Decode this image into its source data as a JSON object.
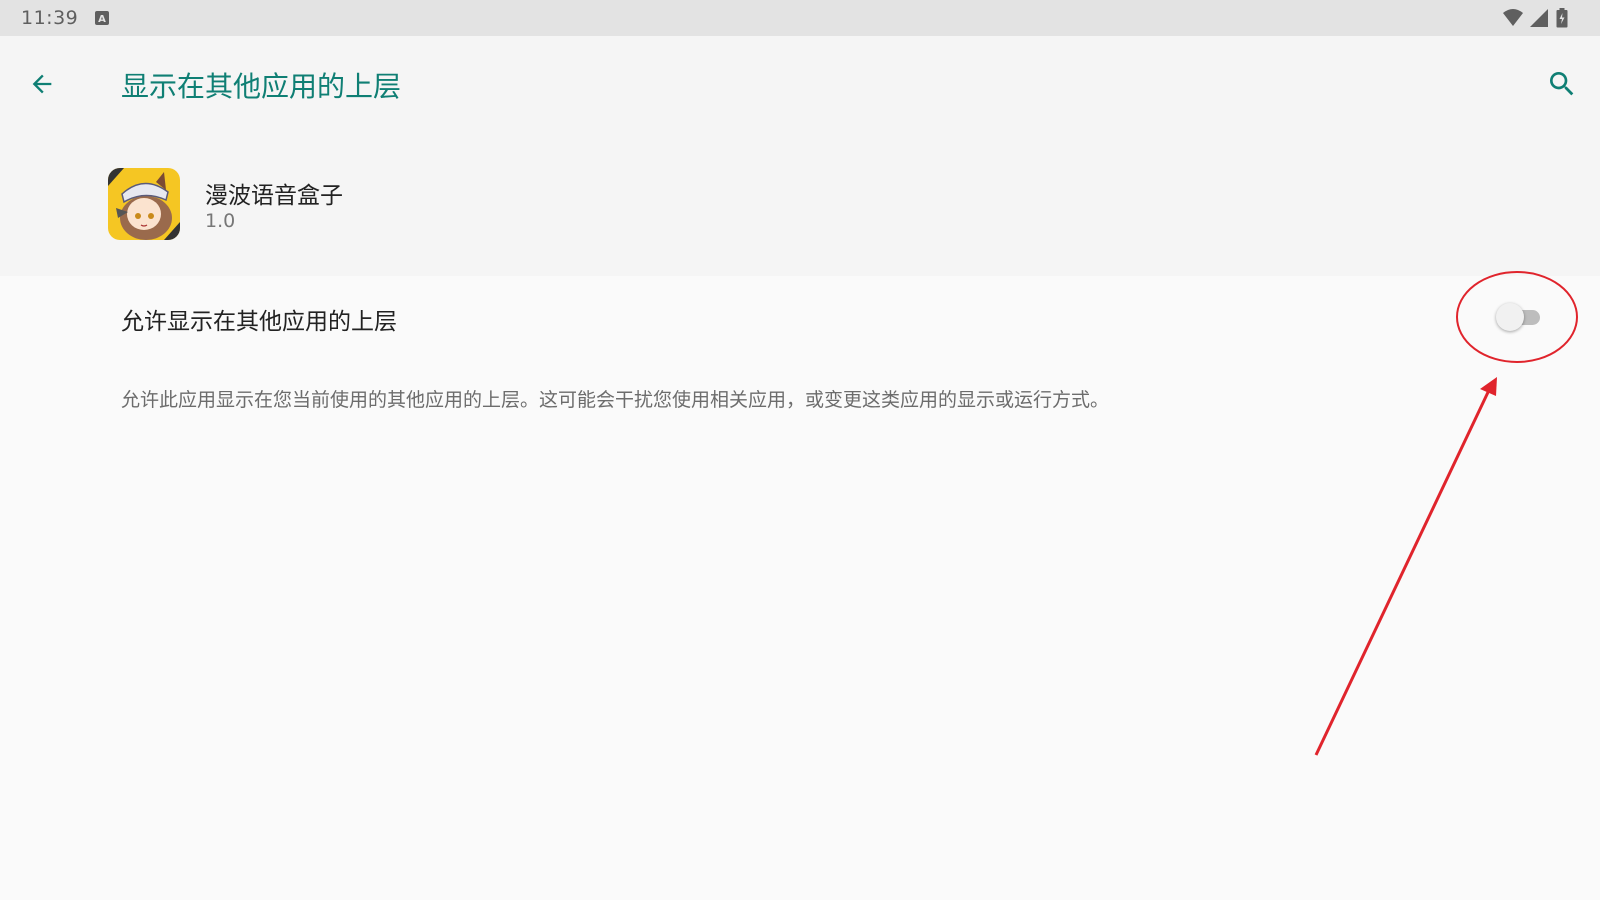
{
  "status_bar": {
    "time": "11:39",
    "icons": [
      "a-icon",
      "wifi-icon",
      "signal-icon",
      "battery-icon"
    ]
  },
  "app_bar": {
    "title": "显示在其他应用的上层",
    "back_icon": "back-arrow-icon",
    "search_icon": "search-icon",
    "accent_color": "#0f7f74"
  },
  "app_info": {
    "name": "漫波语音盒子",
    "version": "1.0"
  },
  "setting": {
    "label": "允许显示在其他应用的上层",
    "enabled": false,
    "description": "允许此应用显示在您当前使用的其他应用的上层。这可能会干扰您使用相关应用，或变更这类应用的显示或运行方式。"
  },
  "annotation": {
    "color": "#e0242c"
  }
}
